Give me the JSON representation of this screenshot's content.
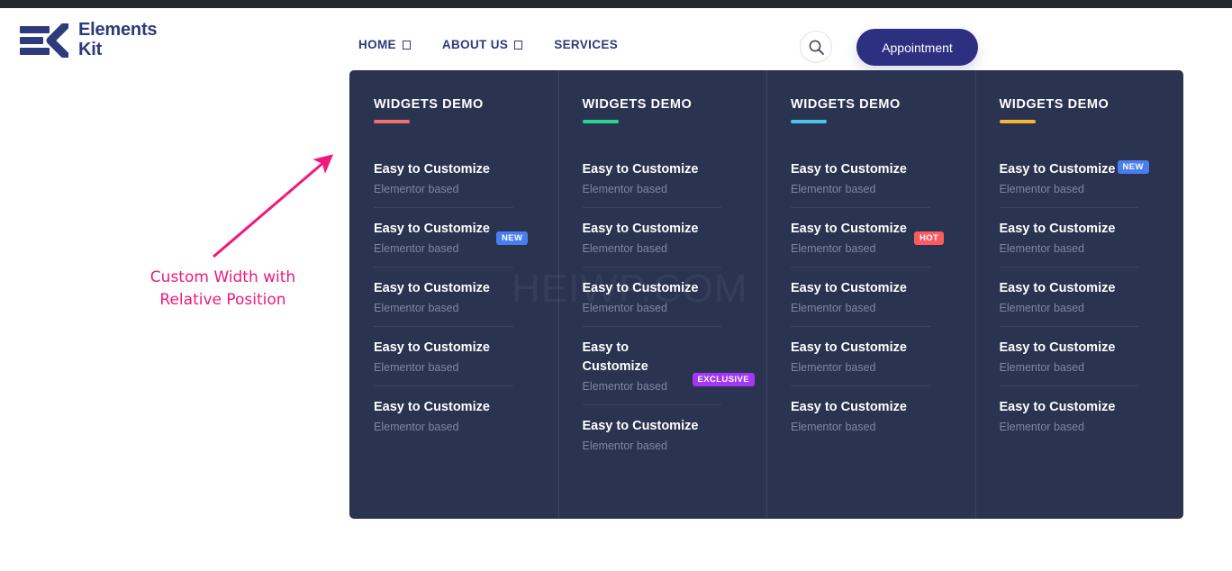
{
  "header": {
    "logo": {
      "line1": "Elements",
      "line2": "Kit",
      "color": "#2d3a7c",
      "icon": "elementskit-logo-icon"
    },
    "nav": [
      {
        "label": "HOME",
        "has_dropdown": true
      },
      {
        "label": "ABOUT US",
        "has_dropdown": true
      },
      {
        "label": "SERVICES",
        "has_dropdown": false
      }
    ],
    "search": {
      "icon": "search-icon",
      "label": "Search"
    },
    "appointment": {
      "label": "Appointment",
      "color": "#2d3080"
    }
  },
  "mega_menu": {
    "background": "#2a3350",
    "columns": [
      {
        "title": "WIDGETS DEMO",
        "accent": "#f2716f",
        "items": [
          {
            "title": "Easy to Customize",
            "subtitle": "Elementor based",
            "badge": null
          },
          {
            "title": "Easy to Customize",
            "subtitle": "Elementor based",
            "badge": {
              "label": "NEW",
              "color": "#4a7ef0"
            }
          },
          {
            "title": "Easy to Customize",
            "subtitle": "Elementor based",
            "badge": null
          },
          {
            "title": "Easy to Customize",
            "subtitle": "Elementor based",
            "badge": null
          },
          {
            "title": "Easy to Customize",
            "subtitle": "Elementor based",
            "badge": null
          }
        ]
      },
      {
        "title": "WIDGETS DEMO",
        "accent": "#2bd694",
        "items": [
          {
            "title": "Easy to Customize",
            "subtitle": "Elementor based",
            "badge": null
          },
          {
            "title": "Easy to Customize",
            "subtitle": "Elementor based",
            "badge": null
          },
          {
            "title": "Easy to Customize",
            "subtitle": "Elementor based",
            "badge": null
          },
          {
            "title": "Easy to Customize",
            "subtitle": "Elementor based",
            "badge": {
              "label": "EXCLUSIVE",
              "color": "#a437f5"
            }
          },
          {
            "title": "Easy to Customize",
            "subtitle": "Elementor based",
            "badge": null
          }
        ]
      },
      {
        "title": "WIDGETS DEMO",
        "accent": "#4ac6ea",
        "items": [
          {
            "title": "Easy to Customize",
            "subtitle": "Elementor based",
            "badge": null
          },
          {
            "title": "Easy to Customize",
            "subtitle": "Elementor based",
            "badge": {
              "label": "HOT",
              "color": "#fb5a5f"
            }
          },
          {
            "title": "Easy to Customize",
            "subtitle": "Elementor based",
            "badge": null
          },
          {
            "title": "Easy to Customize",
            "subtitle": "Elementor based",
            "badge": null
          },
          {
            "title": "Easy to Customize",
            "subtitle": "Elementor based",
            "badge": null
          }
        ]
      },
      {
        "title": "WIDGETS DEMO",
        "accent": "#f7b733",
        "items": [
          {
            "title": "Easy to Customize",
            "subtitle": "Elementor based",
            "badge": {
              "label": "NEW",
              "color": "#4a7ef0"
            }
          },
          {
            "title": "Easy to Customize",
            "subtitle": "Elementor based",
            "badge": null
          },
          {
            "title": "Easy to Customize",
            "subtitle": "Elementor based",
            "badge": null
          },
          {
            "title": "Easy to Customize",
            "subtitle": "Elementor based",
            "badge": null
          },
          {
            "title": "Easy to Customize",
            "subtitle": "Elementor based",
            "badge": null
          }
        ]
      }
    ]
  },
  "watermark": {
    "text": "HEIWP.COM"
  },
  "annotation": {
    "text": "Custom Width with Relative Position",
    "color": "#f0197a",
    "arrow": "arrow-up-right-icon"
  }
}
